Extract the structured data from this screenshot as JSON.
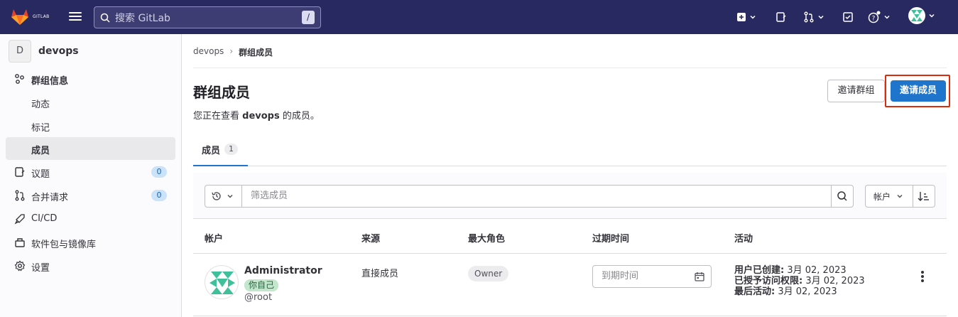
{
  "topbar": {
    "brand": "极狐",
    "brand_sub": "GITLAB",
    "search_placeholder": "搜索 GitLab",
    "search_shortcut": "/"
  },
  "sidebar": {
    "group_initial": "D",
    "group_name": "devops",
    "items": [
      {
        "label": "群组信息",
        "icon": "group-info-icon"
      },
      {
        "label": "动态"
      },
      {
        "label": "标记"
      },
      {
        "label": "成员"
      },
      {
        "label": "议题",
        "count": "0",
        "icon": "issues-icon"
      },
      {
        "label": "合并请求",
        "count": "0",
        "icon": "merge-request-icon"
      },
      {
        "label": "CI/CD",
        "icon": "rocket-icon"
      },
      {
        "label": "软件包与镜像库",
        "icon": "package-icon"
      },
      {
        "label": "设置",
        "icon": "settings-icon"
      }
    ]
  },
  "breadcrumb": {
    "parent": "devops",
    "sep": "›",
    "current": "群组成员"
  },
  "page": {
    "title": "群组成员",
    "desc_prefix": "您正在查看 ",
    "desc_group": "devops",
    "desc_suffix": " 的成员。",
    "invite_group": "邀请群组",
    "invite_members": "邀请成员"
  },
  "tabs": [
    {
      "label": "成员",
      "count": "1"
    }
  ],
  "filter": {
    "placeholder": "筛选成员",
    "sort_label": "帐户"
  },
  "table": {
    "headers": [
      "帐户",
      "来源",
      "最大角色",
      "过期时间",
      "活动"
    ],
    "rows": [
      {
        "name": "Administrator",
        "you_badge": "你自己",
        "handle": "@root",
        "source": "直接成员",
        "role": "Owner",
        "expiration_placeholder": "到期时间",
        "created_label": "用户已创建:",
        "created_value": " 3月 02, 2023",
        "access_label": "已授予访问权限:",
        "access_value": " 3月 02, 2023",
        "last_label": "最后活动:",
        "last_value": " 3月 02, 2023"
      }
    ]
  },
  "colors": {
    "topbar": "#292961",
    "primary": "#1f75cb",
    "highlight": "#dd2b0e"
  }
}
